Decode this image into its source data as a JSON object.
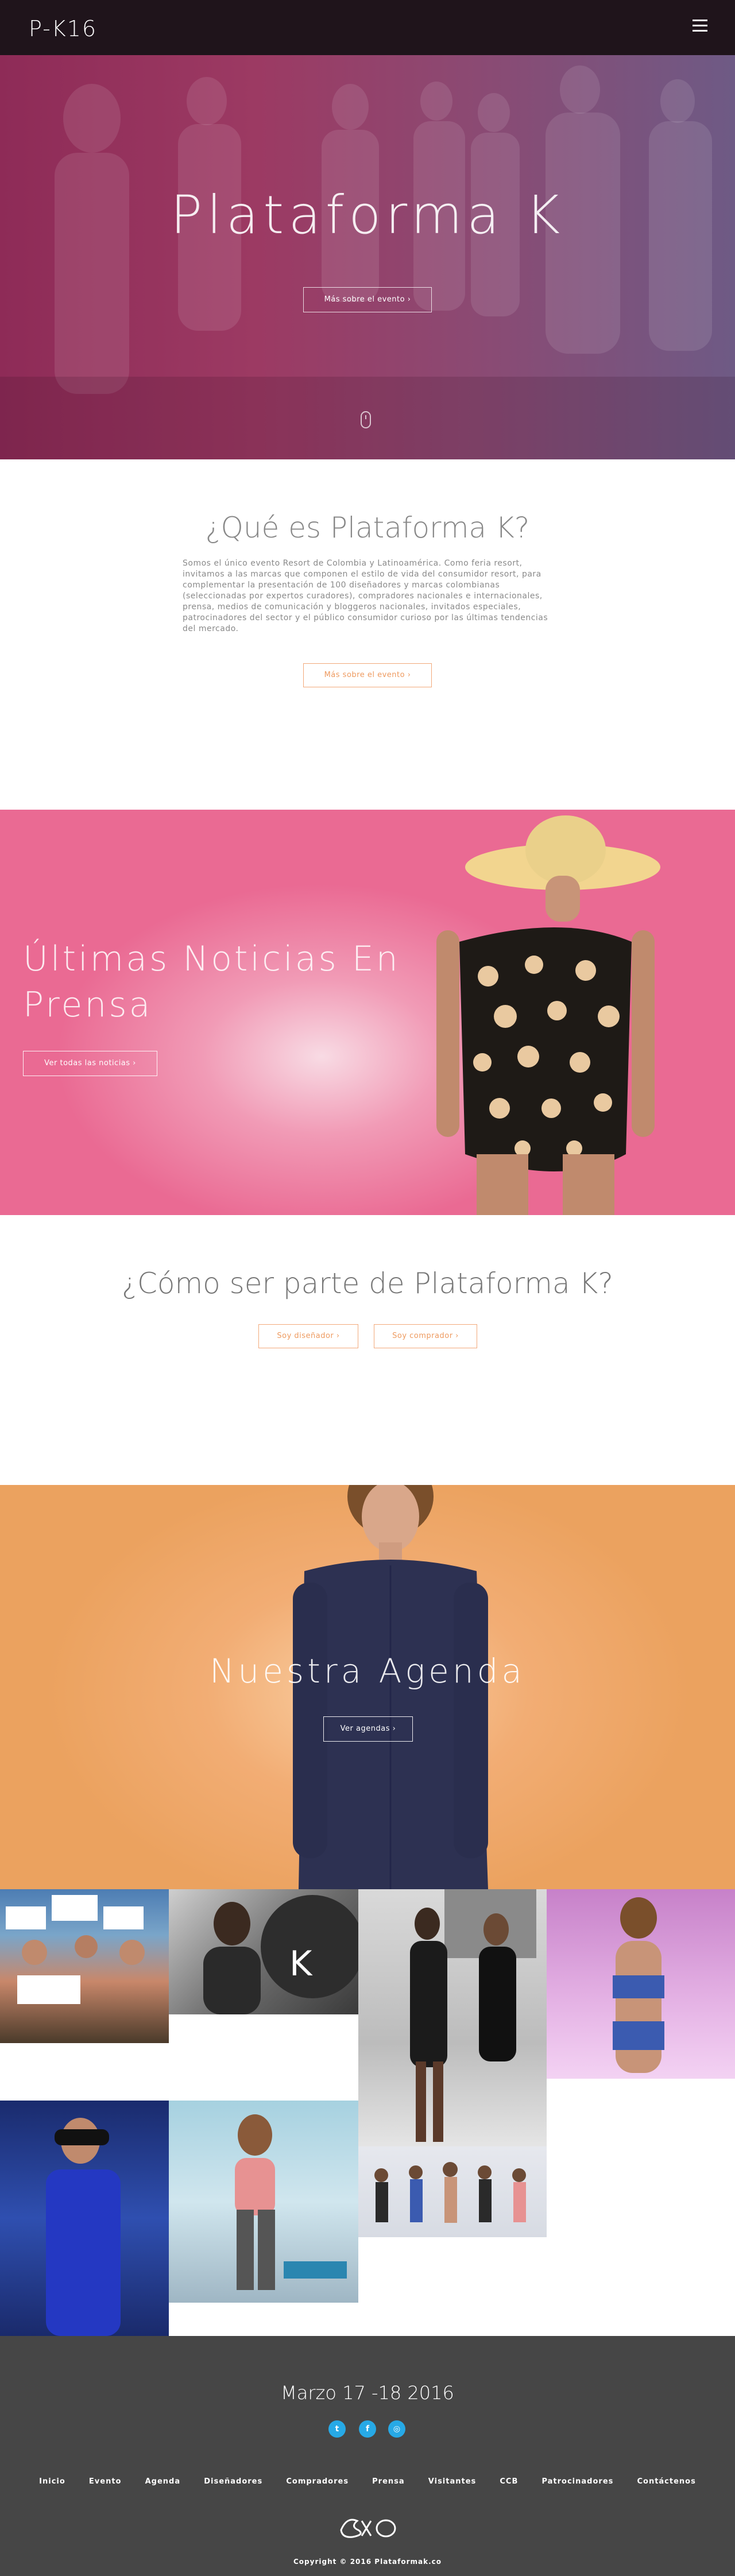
{
  "header": {
    "logo": "P-K16",
    "menu_icon": "hamburger-menu-icon"
  },
  "hero": {
    "title": "Plataforma K",
    "button": "Más sobre el evento  ›",
    "scroll_icon": "mouse-scroll-icon"
  },
  "about": {
    "title": "¿Qué es Plataforma K?",
    "text": "Somos el único evento Resort de Colombia y Latinoamérica. Como feria resort, invitamos a las marcas que componen el estilo de vida del consumidor resort, para complementar la presentación de 100 diseñadores y marcas colombianas (seleccionadas por expertos curadores), compradores nacionales e internacionales, prensa, medios de comunicación y bloggeros nacionales, invitados especiales, patrocinadores del sector y el público consumidor curioso por las últimas tendencias del mercado.",
    "button": "Más sobre el evento  ›"
  },
  "news": {
    "title_line1": "Últimas Noticias En",
    "title_line2": "Prensa",
    "button": "Ver todas las noticias  ›"
  },
  "join": {
    "title": "¿Cómo ser parte de Plataforma K?",
    "designer_button": "Soy diseñador  ›",
    "buyer_button": "Soy comprador  ›"
  },
  "agenda": {
    "title": "Nuestra Agenda",
    "button": "Ver agendas  ›"
  },
  "footer": {
    "date": "Marzo 17 -18 2016",
    "social": [
      {
        "icon": "twitter-icon",
        "glyph": "t"
      },
      {
        "icon": "facebook-icon",
        "glyph": "f"
      },
      {
        "icon": "instagram-icon",
        "glyph": "◎"
      }
    ],
    "nav": [
      "Inicio",
      "Evento",
      "Agenda",
      "Diseñadores",
      "Compradores",
      "Prensa",
      "Visitantes",
      "CCB",
      "Patrocinadores",
      "Contáctenos"
    ],
    "copyright": "Copyright © 2016 Plataformak.co"
  },
  "colors": {
    "accent_orange": "#ee9a5f",
    "news_pink": "#ea6a93",
    "agenda_orange": "#eba25f",
    "footer_bg": "#464646",
    "social_blue": "#27a9e6"
  }
}
